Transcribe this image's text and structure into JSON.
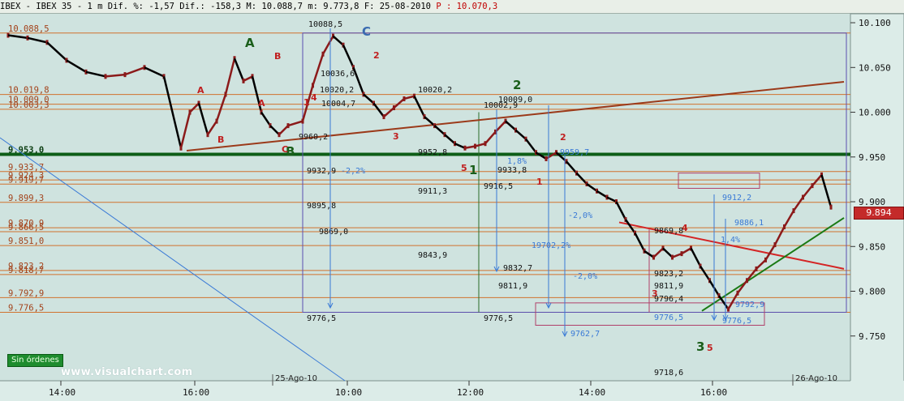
{
  "header": {
    "instrument": "IBEX - IBEX 35 - 1 m Dif. %: -1,57 Dif.: -158,3 M: 10.088,7 m: 9.773,8 F: 25-08-2010",
    "last_price_label": "P : 10.070,3"
  },
  "badges": {
    "orders": "Sin órdenes",
    "watermark": "www.visualchart.com",
    "last_price": "9.894"
  },
  "colors": {
    "background": "#cfe3df",
    "candle_up": "#8b1a1a",
    "candle_down": "#000000",
    "support_line": "#0d5e17",
    "trendline_brown": "#9b3a1a",
    "trendline_red": "#d42424",
    "trendline_green": "#1a7a14",
    "horizontal_orange": "#d0722e",
    "fib_blue": "#3a7ad6",
    "box_purple": "#5b4fb0",
    "box_rose": "#b0406a"
  },
  "chart_data": {
    "type": "candlestick",
    "title": "IBEX 35 - 1 m",
    "ylim": [
      9700,
      10110
    ],
    "y_ticks": [
      "10.100",
      "10.050",
      "10.000",
      "9.950",
      "9.900",
      "9.850",
      "9.800",
      "9.750"
    ],
    "x_ticks": [
      "14:00",
      "16:00",
      "10:00",
      "12:00",
      "14:00",
      "16:00"
    ],
    "date_labels": [
      "25-Ago-10",
      "26-Ago-10"
    ],
    "last_price": 9894,
    "series": [
      {
        "name": "price",
        "points": [
          [
            14.0,
            10086
          ],
          [
            14.25,
            10083
          ],
          [
            14.5,
            10078
          ],
          [
            14.75,
            10058
          ],
          [
            15.0,
            10045
          ],
          [
            15.25,
            10040
          ],
          [
            15.5,
            10042
          ],
          [
            15.75,
            10050
          ],
          [
            15.95,
            10040
          ],
          [
            16.0,
            9960
          ],
          [
            16.1,
            10000
          ],
          [
            16.25,
            10010
          ],
          [
            16.4,
            9975
          ],
          [
            16.55,
            9990
          ],
          [
            16.7,
            10020
          ],
          [
            16.85,
            10060
          ],
          [
            17.0,
            10035
          ],
          [
            17.15,
            10040
          ],
          [
            17.3,
            10000
          ],
          [
            17.45,
            9985
          ],
          [
            17.55,
            9975
          ],
          [
            17.7,
            9985
          ],
          [
            9.0,
            9990
          ],
          [
            9.15,
            10030
          ],
          [
            9.3,
            10065
          ],
          [
            9.45,
            10085
          ],
          [
            9.6,
            10075
          ],
          [
            9.75,
            10050
          ],
          [
            9.9,
            10020
          ],
          [
            10.05,
            10010
          ],
          [
            10.2,
            9995
          ],
          [
            10.35,
            10005
          ],
          [
            10.5,
            10015
          ],
          [
            10.65,
            10018
          ],
          [
            10.8,
            9995
          ],
          [
            10.95,
            9985
          ],
          [
            11.1,
            9975
          ],
          [
            11.25,
            9965
          ],
          [
            11.4,
            9960
          ],
          [
            11.55,
            9962
          ],
          [
            11.7,
            9965
          ],
          [
            11.85,
            9978
          ],
          [
            12.0,
            9990
          ],
          [
            12.15,
            9980
          ],
          [
            12.3,
            9970
          ],
          [
            12.45,
            9955
          ],
          [
            12.6,
            9948
          ],
          [
            12.75,
            9955
          ],
          [
            12.9,
            9945
          ],
          [
            13.05,
            9932
          ],
          [
            13.2,
            9920
          ],
          [
            13.35,
            9912
          ],
          [
            13.5,
            9905
          ],
          [
            13.65,
            9900
          ],
          [
            13.8,
            9880
          ],
          [
            13.95,
            9865
          ],
          [
            14.1,
            9845
          ],
          [
            14.25,
            9838
          ],
          [
            14.4,
            9848
          ],
          [
            14.55,
            9838
          ],
          [
            14.7,
            9842
          ],
          [
            14.85,
            9848
          ],
          [
            15.0,
            9828
          ],
          [
            15.15,
            9812
          ],
          [
            15.3,
            9795
          ],
          [
            15.45,
            9780
          ],
          [
            15.6,
            9798
          ],
          [
            15.75,
            9812
          ],
          [
            15.9,
            9825
          ],
          [
            16.05,
            9835
          ],
          [
            16.2,
            9852
          ],
          [
            16.35,
            9872
          ],
          [
            16.5,
            9890
          ],
          [
            16.65,
            9905
          ],
          [
            16.8,
            9918
          ],
          [
            16.9,
            9930
          ],
          [
            16.96,
            9894
          ]
        ]
      }
    ],
    "levels": [
      {
        "value": 10088.5,
        "label": "10.088,5"
      },
      {
        "value": 10019.8,
        "label": "10.019,8"
      },
      {
        "value": 10009.0,
        "label": "10.009,0"
      },
      {
        "value": 10003.3,
        "label": "10.003,3"
      },
      {
        "value": 9953.0,
        "label": "9.953,0"
      },
      {
        "value": 9933.7,
        "label": "9.933,7"
      },
      {
        "value": 9924.3,
        "label": "9.924,3"
      },
      {
        "value": 9919.7,
        "label": "9.919,7"
      },
      {
        "value": 9899.3,
        "label": "9.899,3"
      },
      {
        "value": 9870.9,
        "label": "9.870,9"
      },
      {
        "value": 9866.5,
        "label": "9.866,5"
      },
      {
        "value": 9851.0,
        "label": "9.851,0"
      },
      {
        "value": 9823.2,
        "label": "9.823,2"
      },
      {
        "value": 9818.7,
        "label": "9.818,7"
      },
      {
        "value": 9792.9,
        "label": "9.792,9"
      },
      {
        "value": 9776.5,
        "label": "9.776,5"
      }
    ],
    "annotations": [
      {
        "text": "A"
      },
      {
        "text": "B"
      },
      {
        "text": "C"
      },
      {
        "text": "1"
      },
      {
        "text": "2"
      },
      {
        "text": "3"
      },
      {
        "text": "4"
      },
      {
        "text": "5"
      },
      {
        "text": "10088,5"
      },
      {
        "text": "10036,6"
      },
      {
        "text": "10020,2"
      },
      {
        "text": "10004,7"
      },
      {
        "text": "9960,2"
      },
      {
        "text": "10020,2"
      },
      {
        "text": "10002,9"
      },
      {
        "text": "10009,0"
      },
      {
        "text": "9952,8"
      },
      {
        "text": "9932,9"
      },
      {
        "text": "9933,8"
      },
      {
        "text": "9916,5"
      },
      {
        "text": "9911,3"
      },
      {
        "text": "9895,8"
      },
      {
        "text": "9869,0"
      },
      {
        "text": "9843,9"
      },
      {
        "text": "9776,5"
      },
      {
        "text": "9776,5"
      },
      {
        "text": "9959,7"
      },
      {
        "text": "9912,2"
      },
      {
        "text": "9886,1"
      },
      {
        "text": "9869,8"
      },
      {
        "text": "9832,7"
      },
      {
        "text": "9823,2"
      },
      {
        "text": "9811,9"
      },
      {
        "text": "9811,9"
      },
      {
        "text": "9796,4"
      },
      {
        "text": "9776,5"
      },
      {
        "text": "9776,5"
      },
      {
        "text": "9762,7"
      },
      {
        "text": "9718,6"
      },
      {
        "text": "9792,9"
      },
      {
        "text": "-2,2%"
      },
      {
        "text": "-2,0%"
      },
      {
        "text": "-2,0%"
      },
      {
        "text": "19702,2%"
      },
      {
        "text": "1,8%"
      },
      {
        "text": "1,4%"
      }
    ]
  }
}
